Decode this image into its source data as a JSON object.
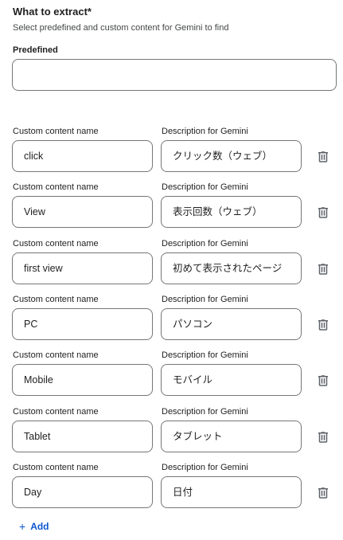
{
  "header": {
    "title": "What to extract*",
    "subtitle": "Select predefined and custom content for Gemini to find"
  },
  "predefined": {
    "label": "Predefined",
    "value": ""
  },
  "rows": [
    {
      "name_label": "Custom content name",
      "desc_label": "Description for Gemini",
      "name": "click",
      "desc": "クリック数（ウェブ）"
    },
    {
      "name_label": "Custom content name",
      "desc_label": "Description for Gemini",
      "name": "View",
      "desc": "表示回数（ウェブ）"
    },
    {
      "name_label": "Custom content name",
      "desc_label": "Description for Gemini",
      "name": "first view",
      "desc": "初めて表示されたページ"
    },
    {
      "name_label": "Custom content name",
      "desc_label": "Description for Gemini",
      "name": "PC",
      "desc": "パソコン"
    },
    {
      "name_label": "Custom content name",
      "desc_label": "Description for Gemini",
      "name": "Mobile",
      "desc": "モバイル"
    },
    {
      "name_label": "Custom content name",
      "desc_label": "Description for Gemini",
      "name": "Tablet",
      "desc": "タブレット"
    },
    {
      "name_label": "Custom content name",
      "desc_label": "Description for Gemini",
      "name": "Day",
      "desc": "日付"
    }
  ],
  "icons": {
    "delete": "trash-icon",
    "add": "plus-icon"
  },
  "add": {
    "plus": "+",
    "label": "Add"
  },
  "colors": {
    "accent": "#0b57d0",
    "border": "#747775",
    "icon": "#5f6368"
  }
}
